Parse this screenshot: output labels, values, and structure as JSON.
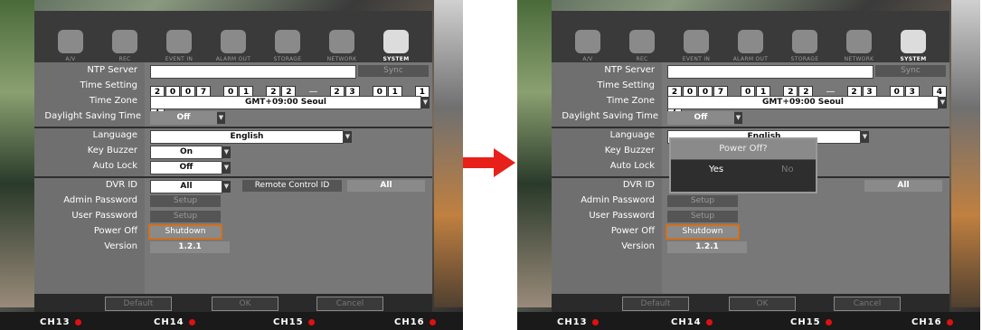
{
  "tabs": [
    "A/V",
    "REC",
    "EVENT IN",
    "ALARM OUT",
    "STORAGE",
    "NETWORK",
    "SYSTEM"
  ],
  "labels": {
    "ntp": "NTP Server",
    "time_setting": "Time Setting",
    "time_zone": "Time Zone",
    "dst": "Daylight Saving Time",
    "language": "Language",
    "key_buzzer": "Key Buzzer",
    "auto_lock": "Auto Lock",
    "dvr_id": "DVR ID",
    "admin_pw": "Admin Password",
    "user_pw": "User Password",
    "power_off": "Power Off",
    "version": "Version"
  },
  "values": {
    "sync": "Sync",
    "time_zone": "GMT+09:00 Seoul",
    "dst": "Off",
    "language": "English",
    "key_buzzer": "On",
    "auto_lock": "Off",
    "dvr_id": "All",
    "remote_label": "Remote Control ID",
    "remote_value": "All",
    "setup": "Setup",
    "shutdown": "Shutdown",
    "version": "1.2.1"
  },
  "left_time": {
    "date": [
      "2",
      "0",
      "0",
      "7",
      "0",
      "1",
      "2",
      "2"
    ],
    "dash": "—",
    "time": [
      "2",
      "3",
      "0",
      "1",
      "1",
      "1"
    ]
  },
  "right_time": {
    "date": [
      "2",
      "0",
      "0",
      "7",
      "0",
      "1",
      "2",
      "2"
    ],
    "dash": "—",
    "time": [
      "2",
      "3",
      "0",
      "3",
      "4",
      "7"
    ]
  },
  "bottom": {
    "default": "Default",
    "ok": "OK",
    "cancel": "Cancel"
  },
  "channels": [
    "CH13",
    "CH14",
    "CH15",
    "CH16"
  ],
  "popup": {
    "title": "Power Off?",
    "yes": "Yes",
    "no": "No"
  },
  "colors": {
    "arrow": "#e8201a",
    "rec_dot": "#e01010",
    "highlight": "#d07020"
  }
}
